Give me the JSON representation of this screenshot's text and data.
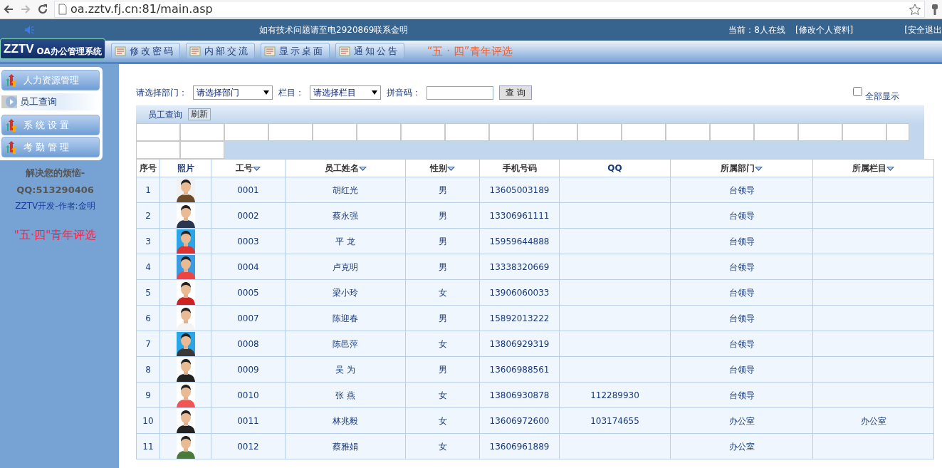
{
  "browser": {
    "url": "oa.zztv.fj.cn:81/main.asp"
  },
  "header": {
    "notice": "如有技术问题请至电2920869联系金明",
    "online": "当前：8人在线",
    "links": [
      "[修改个人资料]",
      "[安全退出"
    ]
  },
  "topbar": {
    "logo": "ZZTV",
    "logo_sub": "OA办公管理系统",
    "tabs": [
      {
        "label": "修改密码"
      },
      {
        "label": "内部交流"
      },
      {
        "label": "显示桌面"
      },
      {
        "label": "通知公告"
      }
    ],
    "banner": "“五 · 四”青年评选"
  },
  "sidebar": {
    "menu": [
      {
        "label": "人力资源管理",
        "children": [
          {
            "label": "员工查询"
          }
        ]
      },
      {
        "label": "系 统 设 置"
      },
      {
        "label": "考 勤 管 理"
      }
    ],
    "info": [
      "解决您的烦恼-",
      "QQ:513290406",
      "ZZTV开发-作者:金明"
    ],
    "banner": "\"五·四\"青年评选"
  },
  "filter": {
    "dept_label": "请选择部门：",
    "dept_value": "请选择部门",
    "column_label": "栏目：",
    "column_value": "请选择栏目",
    "pinyin_label": "拼音码：",
    "search_button": "查 询",
    "show_all": {
      "label": "全部显示",
      "checked": false
    }
  },
  "toolbar": {
    "title": "员工查询",
    "refresh": "刷新"
  },
  "table": {
    "columns": [
      {
        "label": "序号",
        "sortable": false
      },
      {
        "label": "照片",
        "sortable": false
      },
      {
        "label": "工号",
        "sortable": true
      },
      {
        "label": "员工姓名",
        "sortable": true
      },
      {
        "label": "性别",
        "sortable": true
      },
      {
        "label": "手机号码",
        "sortable": false
      },
      {
        "label": "QQ",
        "sortable": false
      },
      {
        "label": "所属部门",
        "sortable": true
      },
      {
        "label": "所属栏目",
        "sortable": true
      }
    ],
    "rows": [
      [
        "1",
        "",
        "0001",
        "胡红光",
        "男",
        "13605003189",
        "",
        "台领导",
        ""
      ],
      [
        "2",
        "",
        "0002",
        "蔡永强",
        "男",
        "13306961111",
        "",
        "台领导",
        ""
      ],
      [
        "3",
        "",
        "0003",
        "平 龙",
        "男",
        "15959644888",
        "",
        "台领导",
        ""
      ],
      [
        "4",
        "",
        "0004",
        "卢克明",
        "男",
        "13338320669",
        "",
        "台领导",
        ""
      ],
      [
        "5",
        "",
        "0005",
        "梁小玲",
        "女",
        "13906060033",
        "",
        "台领导",
        ""
      ],
      [
        "6",
        "",
        "0007",
        "陈迎春",
        "男",
        "15892013222",
        "",
        "台领导",
        ""
      ],
      [
        "7",
        "",
        "0008",
        "陈邑萍",
        "女",
        "13806929319",
        "",
        "台领导",
        ""
      ],
      [
        "8",
        "",
        "0009",
        "吴 为",
        "男",
        "13606988561",
        "",
        "台领导",
        ""
      ],
      [
        "9",
        "",
        "0010",
        "张 燕",
        "女",
        "13806930878",
        "112289930",
        "台领导",
        ""
      ],
      [
        "10",
        "",
        "0011",
        "林兆毅",
        "女",
        "13606972600",
        "103174655",
        "办公室",
        "办公室"
      ],
      [
        "11",
        "",
        "0012",
        "蔡雅娟",
        "女",
        "13606961889",
        "",
        "办公室",
        ""
      ]
    ]
  }
}
